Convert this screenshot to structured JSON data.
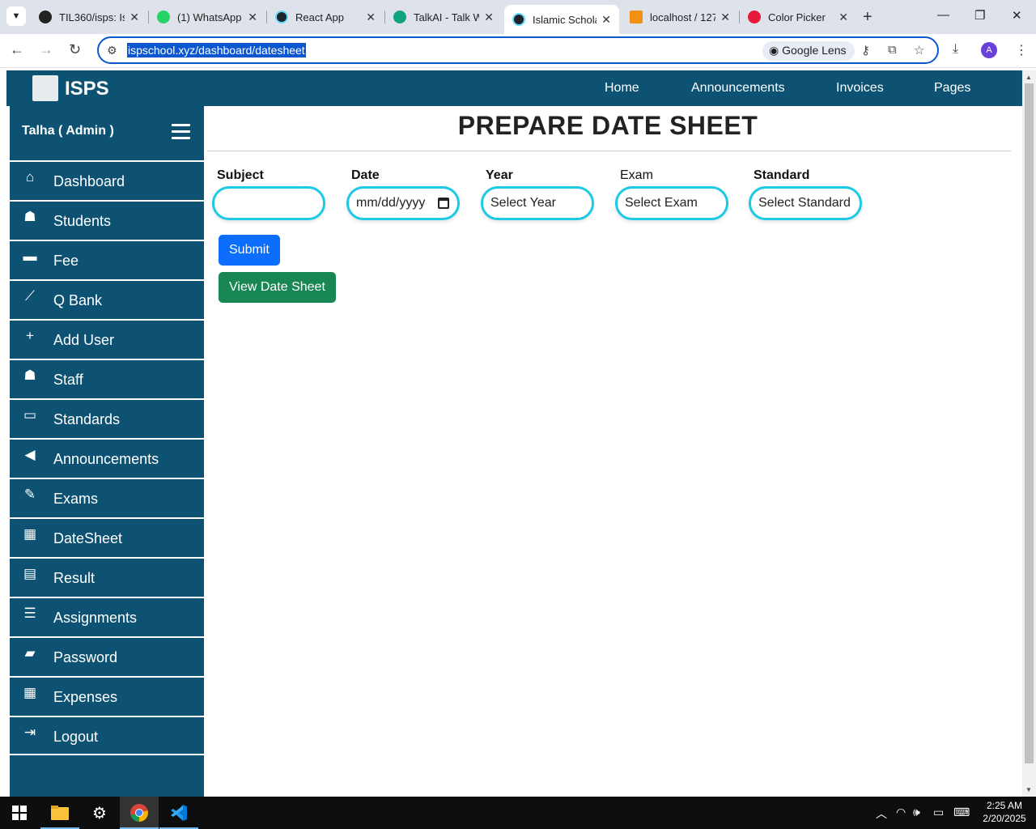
{
  "browser": {
    "tabs": [
      {
        "title": "TIL360/isps: Is",
        "favicon_color": "#222222"
      },
      {
        "title": "(1) WhatsApp",
        "favicon_color": "#25d366"
      },
      {
        "title": "React App",
        "favicon_color": "#20232a"
      },
      {
        "title": "TalkAI - Talk W",
        "favicon_color": "#10a37f"
      },
      {
        "title": "Islamic Schola",
        "favicon_color": "#20232a"
      },
      {
        "title": "localhost / 127",
        "favicon_color": "#f29111"
      },
      {
        "title": "Color Picker",
        "favicon_color": "#e6193b"
      }
    ],
    "active_tab_index": 4,
    "url": "ispschool.xyz/dashboard/datesheet",
    "lens_label": "Google Lens",
    "profile_initial": "A"
  },
  "navbar": {
    "brand": "ISPS",
    "links": [
      "Home",
      "Announcements",
      "Invoices",
      "Pages"
    ]
  },
  "sidebar": {
    "user": "Talha ( Admin )",
    "items": [
      {
        "label": "Dashboard",
        "icon": "home-icon",
        "glyph": "⌂"
      },
      {
        "label": "Students",
        "icon": "student-icon",
        "glyph": "☗"
      },
      {
        "label": "Fee",
        "icon": "wallet-icon",
        "glyph": "▬"
      },
      {
        "label": "Q Bank",
        "icon": "chart-line-icon",
        "glyph": "⟋"
      },
      {
        "label": "Add User",
        "icon": "plus-icon",
        "glyph": "+"
      },
      {
        "label": "Staff",
        "icon": "user-tie-icon",
        "glyph": "☗"
      },
      {
        "label": "Standards",
        "icon": "laptop-icon",
        "glyph": "▭"
      },
      {
        "label": "Announcements",
        "icon": "bullhorn-icon",
        "glyph": "◀"
      },
      {
        "label": "Exams",
        "icon": "edit-icon",
        "glyph": "✎"
      },
      {
        "label": "DateSheet",
        "icon": "calendar-icon",
        "glyph": "▦"
      },
      {
        "label": "Result",
        "icon": "clipboard-icon",
        "glyph": "▤"
      },
      {
        "label": "Assignments",
        "icon": "tasks-icon",
        "glyph": "☰"
      },
      {
        "label": "Password",
        "icon": "lock-icon",
        "glyph": "▰"
      },
      {
        "label": "Expenses",
        "icon": "calculator-icon",
        "glyph": "▦"
      },
      {
        "label": "Logout",
        "icon": "sign-out-icon",
        "glyph": "⇥"
      }
    ]
  },
  "main": {
    "title": "PREPARE DATE SHEET",
    "fields": {
      "subject": {
        "label": "Subject",
        "value": ""
      },
      "date": {
        "label": "Date",
        "placeholder": "mm/dd/yyyy"
      },
      "year": {
        "label": "Year",
        "value": "Select Year"
      },
      "exam": {
        "label": "Exam",
        "value": "Select Exam"
      },
      "standard": {
        "label": "Standard",
        "value": "Select Standard"
      }
    },
    "submit_label": "Submit",
    "view_label": "View Date Sheet"
  },
  "taskbar": {
    "time": "2:25 AM",
    "date": "2/20/2025"
  },
  "colors": {
    "primary_dark": "#0d5272",
    "input_border": "#1ec9e6",
    "submit": "#0d6efd",
    "view": "#198754"
  }
}
